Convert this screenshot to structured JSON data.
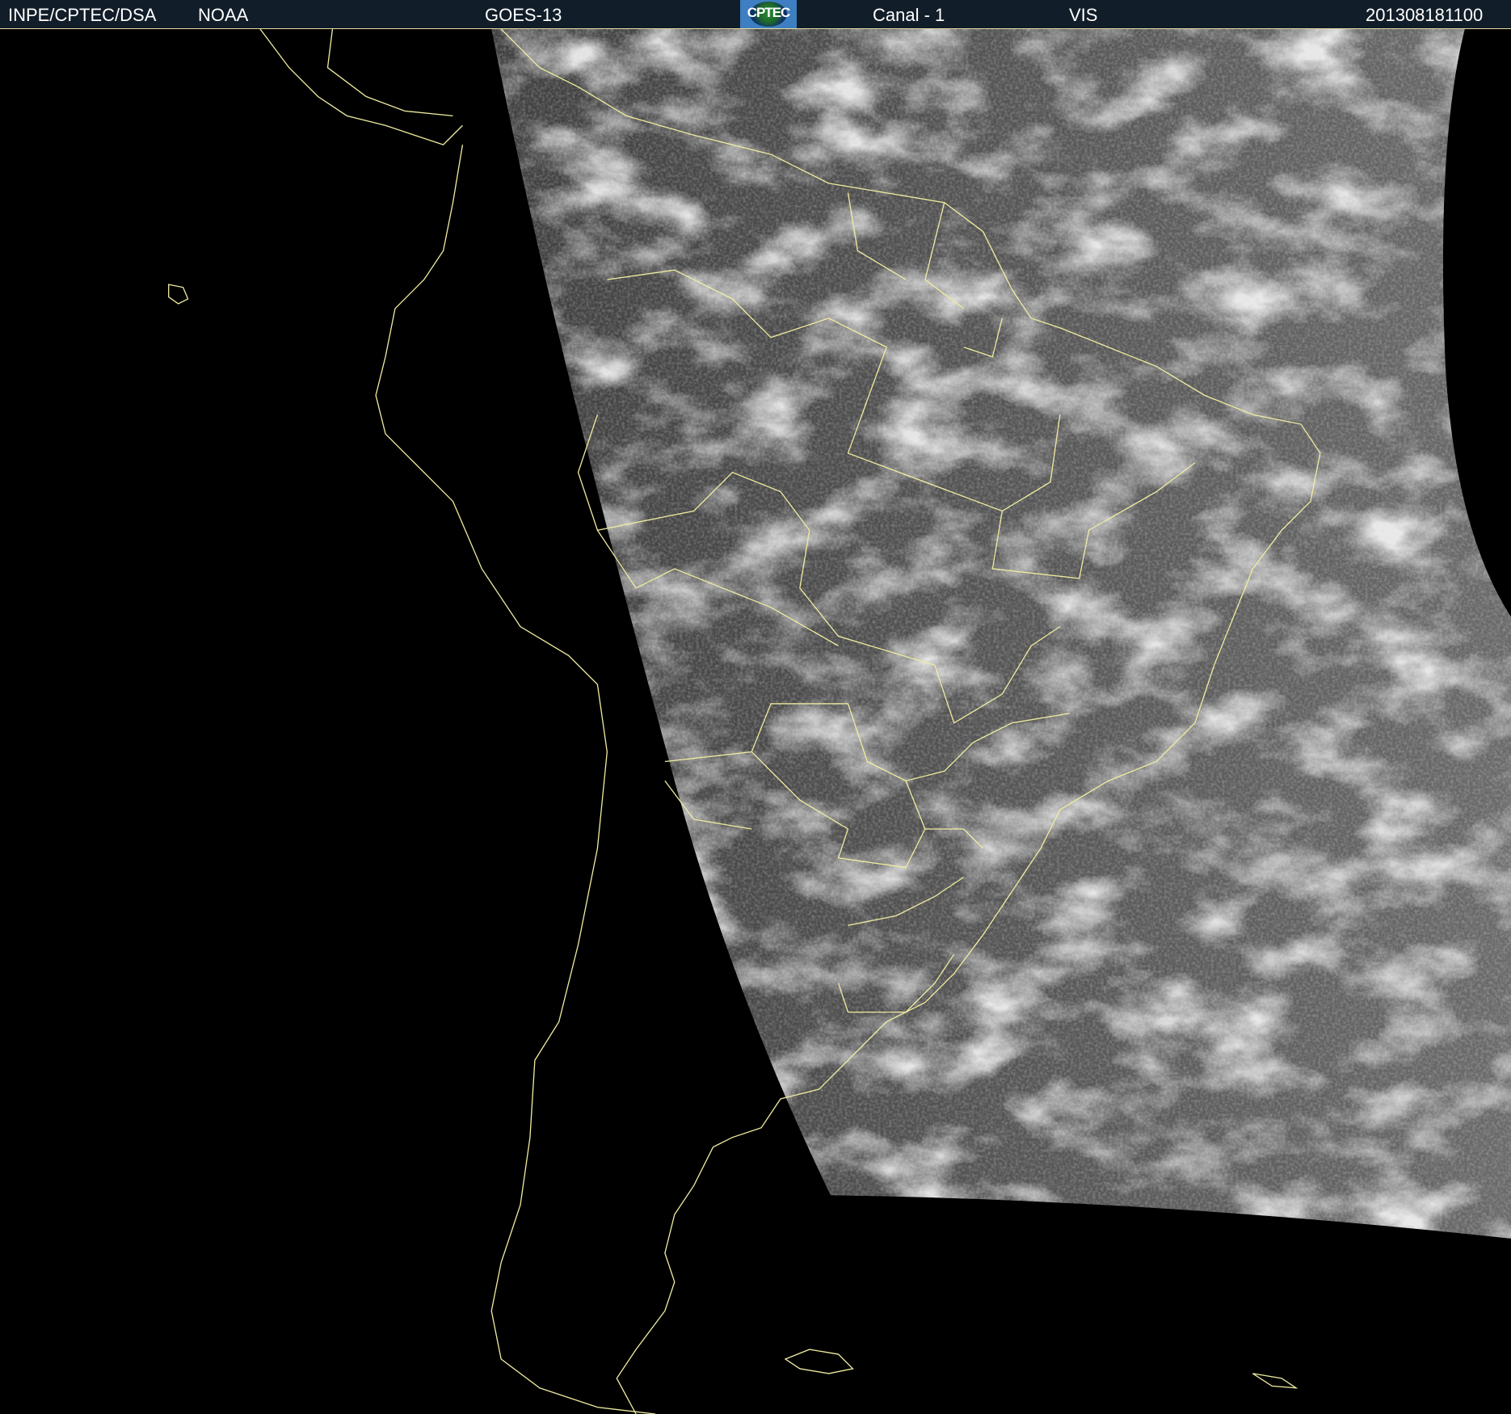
{
  "header": {
    "institution": "INPE/CPTEC/DSA",
    "agency": "NOAA",
    "satellite": "GOES-13",
    "logo_text": "CPTEC",
    "channel": "Canal - 1",
    "band": "VIS",
    "timestamp": "201308181100"
  },
  "colors": {
    "header_bg": "#111d28",
    "coastline": "#f0eca0",
    "background": "#000000"
  }
}
